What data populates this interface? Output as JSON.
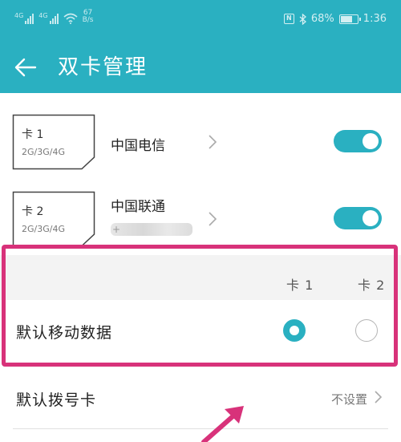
{
  "status_bar": {
    "sim1_network": "4G",
    "sim2_network": "4G",
    "speed_value": "67",
    "speed_unit": "B/s",
    "battery": "68%",
    "time": "1:36"
  },
  "app_bar": {
    "title": "双卡管理"
  },
  "sim_cards": [
    {
      "card_label": "卡 1",
      "network_types": "2G/3G/4G",
      "carrier": "中国电信",
      "number": "",
      "enabled": true
    },
    {
      "card_label": "卡 2",
      "network_types": "2G/3G/4G",
      "carrier": "中国联通",
      "number": "+",
      "enabled": true
    }
  ],
  "defaults": {
    "col_card1": "卡 1",
    "col_card2": "卡 2",
    "mobile_data_label": "默认移动数据",
    "mobile_data_selected": 1
  },
  "dial": {
    "label": "默认拨号卡",
    "value": "不设置"
  },
  "colors": {
    "accent": "#2ab0c1",
    "highlight_annotation": "#d8327a"
  },
  "icons": [
    "back-arrow-icon",
    "chevron-right-icon",
    "nfc-icon",
    "bluetooth-icon",
    "battery-icon",
    "wifi-icon",
    "signal-icon"
  ]
}
